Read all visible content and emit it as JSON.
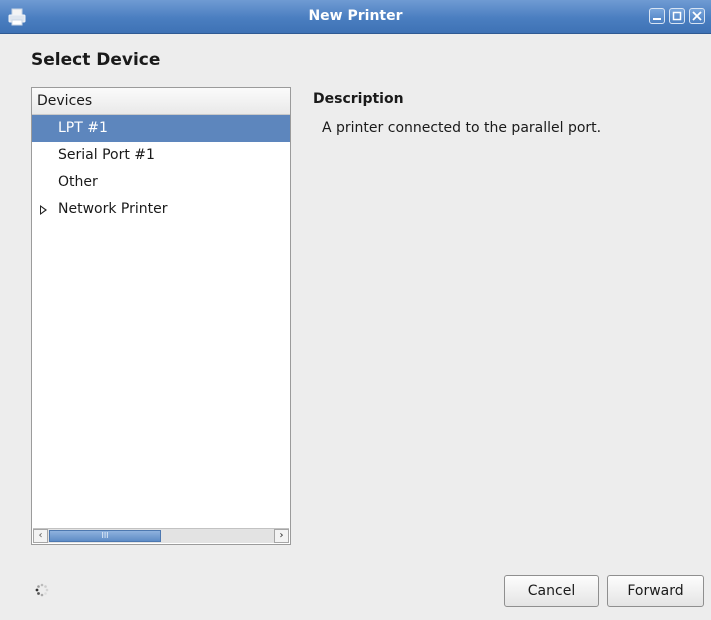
{
  "window": {
    "title": "New Printer",
    "icon": "printer-icon"
  },
  "page": {
    "heading": "Select Device"
  },
  "devices": {
    "header": "Devices",
    "items": [
      {
        "label": "LPT #1",
        "selected": true,
        "expandable": false
      },
      {
        "label": "Serial Port #1",
        "selected": false,
        "expandable": false
      },
      {
        "label": "Other",
        "selected": false,
        "expandable": false
      },
      {
        "label": "Network Printer",
        "selected": false,
        "expandable": true
      }
    ],
    "scrollbar_thumb_glyph": "III"
  },
  "description": {
    "title": "Description",
    "text": "A printer connected to the parallel port."
  },
  "buttons": {
    "cancel_label": "Cancel",
    "forward_label": "Forward"
  },
  "colors": {
    "titlebar": "#4a7ec0",
    "selection": "#5d86bd"
  }
}
